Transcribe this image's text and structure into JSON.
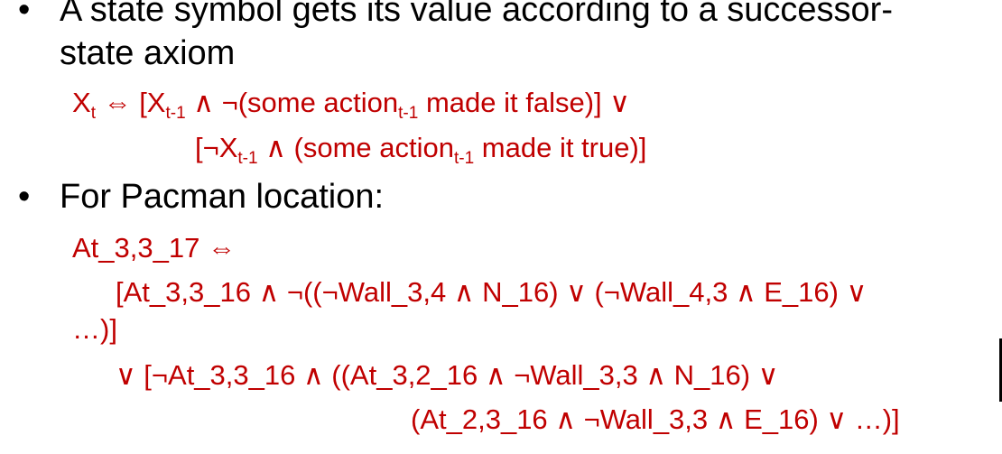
{
  "bullets": [
    {
      "marker": "•",
      "line1": "A state symbol gets its value according to a successor-",
      "line2": "state axiom"
    },
    {
      "marker": "•",
      "line1": "For Pacman location:"
    }
  ],
  "axiom": {
    "line1": {
      "x": "X",
      "x_sub": "t",
      "rest1": " ⇔ [X",
      "sub1": "t-1",
      "rest2": " ∧ ¬(some action",
      "sub2": "t-1",
      "rest3": " made it false)] ∨"
    },
    "line2": {
      "rest1": "[¬X",
      "sub1": "t-1",
      "rest2": " ∧ (some action",
      "sub2": "t-1",
      "rest3": " made it true)]"
    }
  },
  "pacman": {
    "line1": "At_3,3_17 ⇔",
    "line2": "[At_3,3_16 ∧ ¬((¬Wall_3,4 ∧ N_16) ∨ (¬Wall_4,3 ∧ E_16) ∨",
    "line3": "…)]",
    "line4": "∨ [¬At_3,3_16 ∧ ((At_3,2_16 ∧ ¬Wall_3,3 ∧ N_16) ∨",
    "line5": "(At_2,3_16 ∧ ¬Wall_3,3 ∧ E_16) ∨ …)]"
  },
  "colors": {
    "text": "#000000",
    "formula": "#c00000"
  }
}
